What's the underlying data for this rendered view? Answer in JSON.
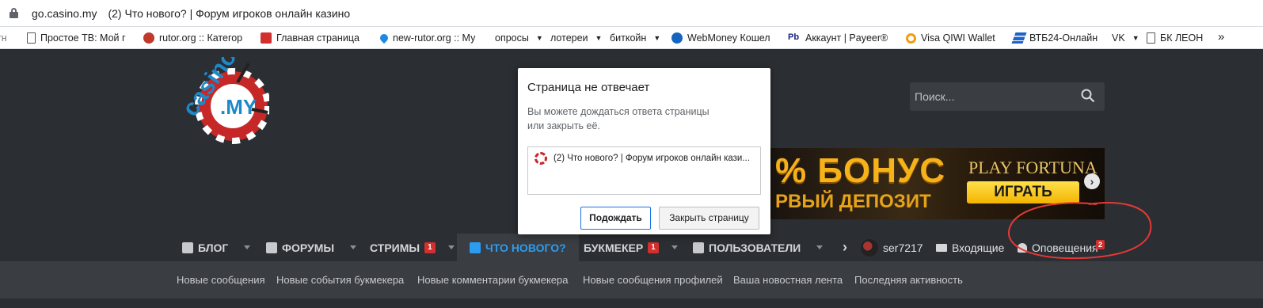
{
  "browser": {
    "url_host": "go.casino.my",
    "tab_title": "(2) Что нового? | Форум игроков онлайн казино"
  },
  "bookmarks": [
    {
      "label": "Простое ТВ: Мой г",
      "icon": "page-icon"
    },
    {
      "label": "rutor.org :: Категор",
      "icon": "star-icon"
    },
    {
      "label": "Главная страница",
      "icon": "red-square-icon"
    },
    {
      "label": "new-rutor.org :: Му",
      "icon": "drop-icon"
    },
    {
      "label": "опросы",
      "folder": true
    },
    {
      "label": "лотереи",
      "folder": true
    },
    {
      "label": "биткойн",
      "folder": true
    },
    {
      "label": "WebMoney Кошел",
      "icon": "globe-icon"
    },
    {
      "label": "Аккаунт | Payeer®",
      "icon": "pb-icon"
    },
    {
      "label": "Visa QIWI Wallet",
      "icon": "qiwi-icon"
    },
    {
      "label": "ВТБ24-Онлайн",
      "icon": "vtb-icon"
    },
    {
      "label": "VK",
      "folder": true
    },
    {
      "label": "БК ЛЕОН",
      "icon": "page-icon"
    },
    {
      "label": "»"
    }
  ],
  "site": {
    "logo_text": "casino .MY",
    "search_placeholder": "Поиск...",
    "banner": {
      "line1": "% БОНУС",
      "line2": "РВЫЙ ДЕПОЗИТ",
      "brand": "PLAY FORTUNA",
      "cta": "ИГРАТЬ"
    }
  },
  "nav": {
    "blog": "БЛОГ",
    "forums": "ФОРУМЫ",
    "streams": "СТРИМЫ",
    "streams_badge": "1",
    "whats_new": "ЧТО НОВОГО?",
    "bookmaker": "БУКМЕКЕР",
    "bookmaker_badge": "1",
    "users": "ПОЛЬЗОВАТЕЛИ",
    "more": "›",
    "username": "ser7217",
    "inbox": "Входящие",
    "alerts": "Оповещения",
    "alerts_badge": "2"
  },
  "subnav": [
    "Новые сообщения",
    "Новые события букмекера",
    "Новые комментарии букмекера",
    "Новые сообщения профилей",
    "Ваша новостная лента",
    "Последняя активность"
  ],
  "dialog": {
    "title": "Страница не отвечает",
    "message_line1": "Вы можете дождаться ответа страницы",
    "message_line2": "или закрыть её.",
    "page_item": "(2) Что нового? | Форум игроков онлайн кази...",
    "wait_label": "Подождать",
    "close_label": "Закрыть страницу"
  },
  "colors": {
    "site_bg": "#2b2e33",
    "subnav_bg": "#3a3d42",
    "accent": "#2c9cf0",
    "badge": "#d32f2f",
    "annotation": "#e53935"
  }
}
